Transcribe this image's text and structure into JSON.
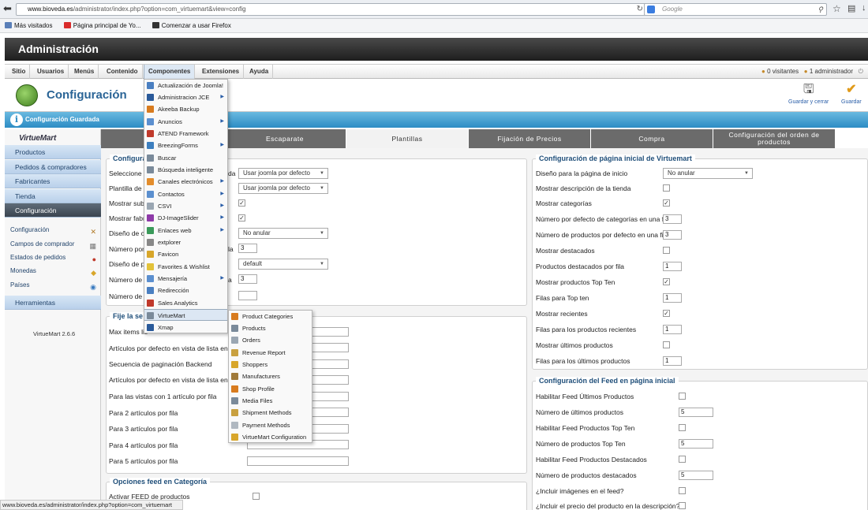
{
  "browser": {
    "url_host": "www.bioveda.es",
    "url_path": "/administrator/index.php?option=com_virtuemart&view=config",
    "search_placeholder": "Google",
    "bookmarks": [
      "Más visitados",
      "Página principal de Yo...",
      "Comenzar a usar Firefox"
    ]
  },
  "admin": {
    "title": "Administración",
    "menu": [
      "Sitio",
      "Usuarios",
      "Menús",
      "Contenido",
      "Componentes",
      "Extensiones",
      "Ayuda"
    ],
    "visitors": "0 visitantes",
    "admins": "1 administrador"
  },
  "toolbar": {
    "title": "Configuración",
    "save_close": "Guardar y cerrar",
    "save": "Guardar"
  },
  "message": "Configuración Guardada",
  "sidebar": {
    "logo": "VirtueMart",
    "main_items": [
      "Productos",
      "Pedidos & compradores",
      "Fabricantes",
      "Tienda",
      "Configuración"
    ],
    "sub_items": [
      "Configuración",
      "Campos de comprador",
      "Estados de pedidos",
      "Monedas",
      "Países"
    ],
    "tools": "Herramientas",
    "version": "VirtueMart 2.6.6"
  },
  "tabs": [
    "Escaparate",
    "Plantillas",
    "Fijación de Precios",
    "Compra",
    "Configuración del orden de productos"
  ],
  "left_panel": {
    "legend1": "Configura",
    "rows": [
      {
        "label": "Seleccione l",
        "tail": "da",
        "select": "Usar joomla por defecto"
      },
      {
        "label": "Plantilla de c",
        "select": "Usar joomla por defecto"
      },
      {
        "label": "Mostrar sub",
        "checked": "✓"
      },
      {
        "label": "Mostrar fabr",
        "checked": "✓"
      },
      {
        "label": "Diseño de c",
        "select": "No anular"
      },
      {
        "label": "Número por",
        "tail": "la",
        "input": "3"
      },
      {
        "label": "Diseño de p",
        "select": "default"
      },
      {
        "label": "Número de p",
        "tail": "a",
        "input": "3"
      },
      {
        "label": "Número de f",
        "input": ""
      }
    ],
    "legend2": "Fije la se",
    "rows2": [
      "Max items lis",
      "Artículos por defecto en vista de lista en Ba",
      "Secuencia de paginación Backend",
      "Artículos por defecto en vista de lista en Fro",
      "Para las vistas con 1 artículo por fila",
      "Para 2 artículos por fila",
      "Para 3 artículos por fila",
      "Para 4 artículos por fila",
      "Para 5 artículos por fila"
    ],
    "legend3": "Opciones feed en Categoría",
    "rows3": [
      "Activar FEED de productos"
    ]
  },
  "right_panel": {
    "legend1": "Configuración de página inicial de Virtuemart",
    "rows": [
      {
        "label": "Diseño para la página de inicio",
        "select": "No anular"
      },
      {
        "label": "Mostrar descripción de la tienda",
        "checked": ""
      },
      {
        "label": "Mostrar categorías",
        "checked": "✓"
      },
      {
        "label": "Número por defecto de categorías en una fila",
        "input": "3"
      },
      {
        "label": "Número de productos por defecto en una fila",
        "input": "3"
      },
      {
        "label": "Mostrar destacados",
        "checked": ""
      },
      {
        "label": "Productos destacados por fila",
        "input": "1"
      },
      {
        "label": "Mostrar productos Top Ten",
        "checked": "✓"
      },
      {
        "label": "Filas para Top ten",
        "input": "1"
      },
      {
        "label": "Mostrar recientes",
        "checked": "✓"
      },
      {
        "label": "Filas para los productos recientes",
        "input": "1"
      },
      {
        "label": "Mostrar últimos productos",
        "checked": ""
      },
      {
        "label": "Filas para los últimos productos",
        "input": "1"
      }
    ],
    "legend2": "Configuración del Feed en página inicial",
    "rows2": [
      {
        "label": "Habilitar Feed Últimos Productos",
        "checked": ""
      },
      {
        "label": "Número de últimos productos",
        "input": "5"
      },
      {
        "label": "Habilitar Feed Productos Top Ten",
        "checked": ""
      },
      {
        "label": "Número de productos Top Ten",
        "input": "5"
      },
      {
        "label": "Habilitar Feed Productos Destacados",
        "checked": ""
      },
      {
        "label": "Número de productos destacados",
        "input": "5"
      },
      {
        "label": "¿Incluir imágenes en el feed?",
        "checked": ""
      },
      {
        "label": "¿Incluir el precio del producto en la descripción?",
        "checked": ""
      }
    ]
  },
  "components_menu": [
    {
      "label": "Actualización de Joomla!",
      "color": "#4a7fc1"
    },
    {
      "label": "Administracion JCE",
      "color": "#2a5a9a",
      "sub": "▶"
    },
    {
      "label": "Akeeba Backup",
      "color": "#d87b1e"
    },
    {
      "label": "Anuncios",
      "color": "#5b8fcf",
      "sub": "▶"
    },
    {
      "label": "ATEND Framework",
      "color": "#c03a2b"
    },
    {
      "label": "BreezingForms",
      "color": "#3d7fbf",
      "sub": "▶"
    },
    {
      "label": "Buscar",
      "color": "#7a8a9a"
    },
    {
      "label": "Búsqueda inteligente",
      "color": "#7a8a9a"
    },
    {
      "label": "Canales electrónicos",
      "color": "#e38d2c",
      "sub": "▶"
    },
    {
      "label": "Contactos",
      "color": "#5b8fcf",
      "sub": "▶"
    },
    {
      "label": "CSVI",
      "color": "#9aa6b2",
      "sub": "▶"
    },
    {
      "label": "DJ-ImageSlider",
      "color": "#8e3aa8",
      "sub": "▶"
    },
    {
      "label": "Enlaces web",
      "color": "#3a9a5a",
      "sub": "▶"
    },
    {
      "label": "extplorer",
      "color": "#888888"
    },
    {
      "label": "Favicon",
      "color": "#d8a62a"
    },
    {
      "label": "Favorites & Wishlist",
      "color": "#e2c23a"
    },
    {
      "label": "Mensajería",
      "color": "#5b8fcf",
      "sub": "▶"
    },
    {
      "label": "Redirección",
      "color": "#4a7fc1"
    },
    {
      "label": "Sales Analytics",
      "color": "#c0392b"
    },
    {
      "label": "VirtueMart",
      "color": "#7a8a9a"
    },
    {
      "label": "Xmap",
      "color": "#2a5a9a"
    }
  ],
  "virtuemart_menu": [
    {
      "label": "Product Categories",
      "color": "#d87b1e"
    },
    {
      "label": "Products",
      "color": "#7a8a9a"
    },
    {
      "label": "Orders",
      "color": "#9aa6b2"
    },
    {
      "label": "Revenue Report",
      "color": "#c8a040"
    },
    {
      "label": "Shoppers",
      "color": "#d8a62a"
    },
    {
      "label": "Manufacturers",
      "color": "#a07a3a"
    },
    {
      "label": "Shop Profile",
      "color": "#d87b1e"
    },
    {
      "label": "Media Files",
      "color": "#7a8a9a"
    },
    {
      "label": "Shipment Methods",
      "color": "#c8a040"
    },
    {
      "label": "Payment Methods",
      "color": "#b0b8c0"
    },
    {
      "label": "VirtueMart Configuration",
      "color": "#d8a62a"
    }
  ],
  "status_bar": "www.bioveda.es/administrator/index.php?option=com_virtuemart"
}
